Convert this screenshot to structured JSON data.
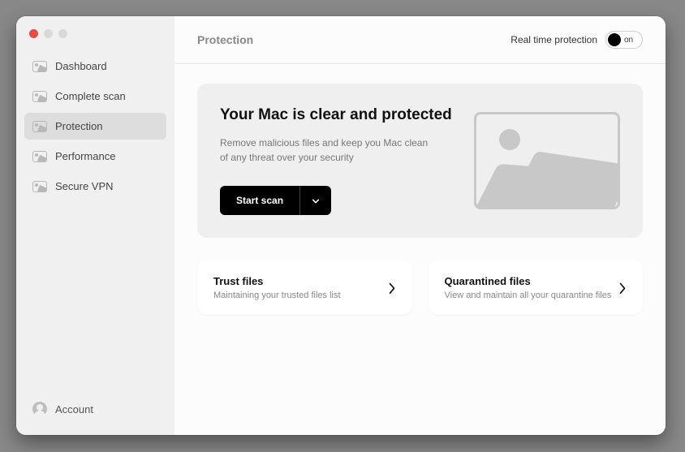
{
  "sidebar": {
    "items": [
      {
        "label": "Dashboard"
      },
      {
        "label": "Complete scan"
      },
      {
        "label": "Protection"
      },
      {
        "label": "Performance"
      },
      {
        "label": "Secure VPN"
      }
    ],
    "account_label": "Account"
  },
  "header": {
    "title": "Protection",
    "rtp_label": "Real time protection",
    "toggle_state": "on"
  },
  "hero": {
    "title": "Your Mac is clear and protected",
    "subtitle": "Remove malicious files and keep you Mac clean of any threat over your security",
    "scan_label": "Start scan"
  },
  "cards": {
    "trust": {
      "title": "Trust files",
      "subtitle": "Maintaining your trusted files list"
    },
    "quarantine": {
      "title": "Quarantined files",
      "subtitle": "View and maintain all your quarantine files"
    }
  }
}
